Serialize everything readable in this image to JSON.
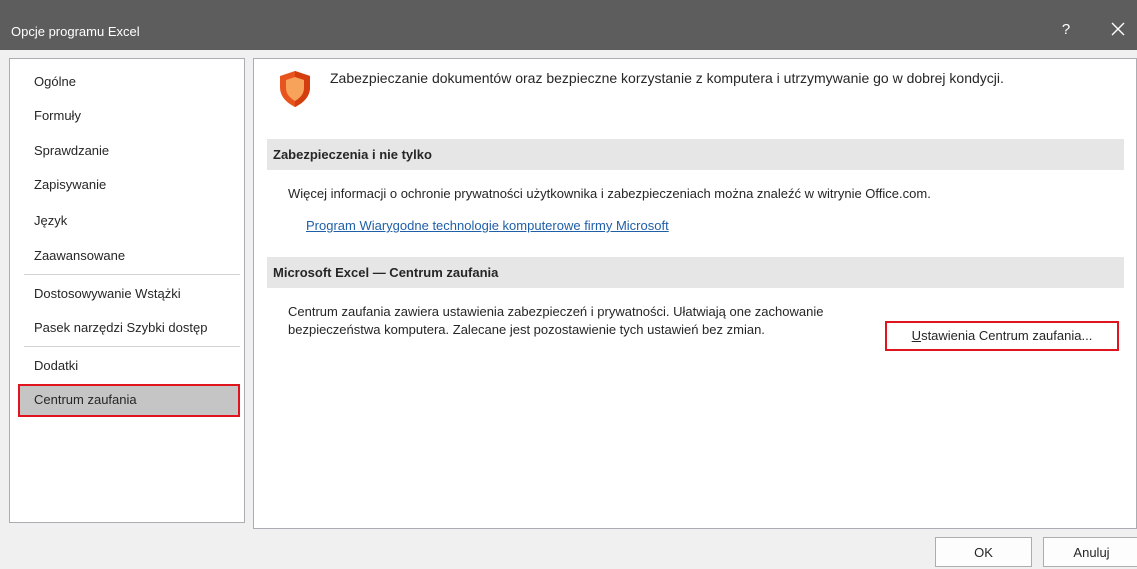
{
  "window": {
    "title": "Opcje programu Excel",
    "help_glyph": "?",
    "close_icon": "close-icon"
  },
  "sidebar": {
    "selected": "Centrum zaufania",
    "items": [
      {
        "label": "Ogólne"
      },
      {
        "label": "Formuły"
      },
      {
        "label": "Sprawdzanie"
      },
      {
        "label": "Zapisywanie"
      },
      {
        "label": "Język"
      },
      {
        "label": "Zaawansowane"
      },
      {
        "label": "Dostosowywanie Wstążki"
      },
      {
        "label": "Pasek narzędzi Szybki dostęp"
      },
      {
        "label": "Dodatki"
      },
      {
        "label": "Centrum zaufania"
      }
    ]
  },
  "main": {
    "header_icon": "shield-icon",
    "header_text": "Zabezpieczanie dokumentów oraz bezpieczne korzystanie z komputera i utrzymywanie go w dobrej kondycji.",
    "sections": [
      {
        "title": "Zabezpieczenia i nie tylko",
        "text": "Więcej informacji o ochronie prywatności użytkownika i zabezpieczeniach można znaleźć w witrynie Office.com.",
        "link": "Program Wiarygodne technologie komputerowe firmy Microsoft"
      },
      {
        "title": "Microsoft Excel — Centrum zaufania",
        "text": "Centrum zaufania zawiera ustawienia zabezpieczeń i prywatności. Ułatwiają one zachowanie bezpieczeństwa komputera. Zalecane jest pozostawienie tych ustawień bez zmian.",
        "button_accel": "U",
        "button_rest": "stawienia Centrum zaufania..."
      }
    ]
  },
  "footer": {
    "ok": "OK",
    "cancel": "Anuluj"
  },
  "colors": {
    "titlebar": "#5d5d5d",
    "highlight": "#e0141e",
    "link": "#1f5fa8",
    "shield": "#e8541e"
  }
}
